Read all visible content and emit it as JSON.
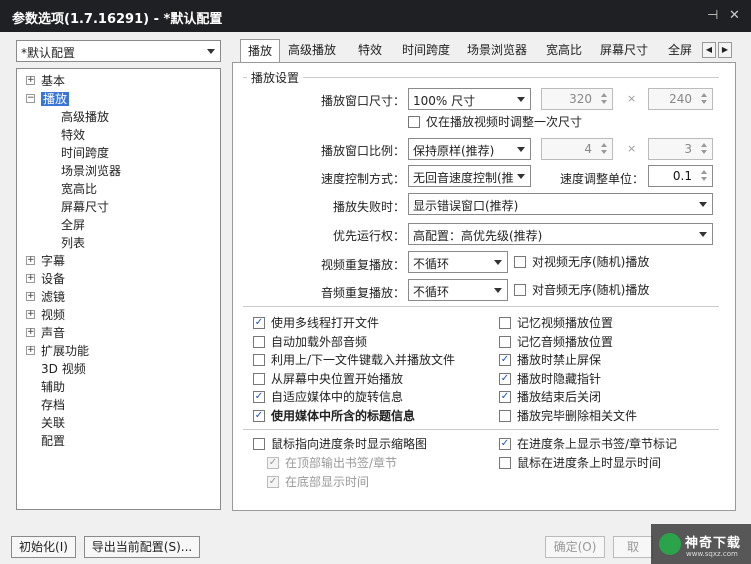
{
  "window": {
    "title": "参数选项(1.7.16291) - *默认配置",
    "pin_glyph": "⊣",
    "close_glyph": "✕"
  },
  "profile_select": {
    "value": "*默认配置"
  },
  "tree": [
    {
      "label": "基本",
      "expander": "+"
    },
    {
      "label": "播放",
      "expander": "−",
      "selected": true
    },
    {
      "label": "高级播放"
    },
    {
      "label": "特效"
    },
    {
      "label": "时间跨度"
    },
    {
      "label": "场景浏览器"
    },
    {
      "label": "宽高比"
    },
    {
      "label": "屏幕尺寸"
    },
    {
      "label": "全屏"
    },
    {
      "label": "列表"
    },
    {
      "label": "字幕",
      "expander": "+"
    },
    {
      "label": "设备",
      "expander": "+"
    },
    {
      "label": "滤镜",
      "expander": "+"
    },
    {
      "label": "视频",
      "expander": "+"
    },
    {
      "label": "声音",
      "expander": "+"
    },
    {
      "label": "扩展功能",
      "expander": "+"
    },
    {
      "label": "3D 视频"
    },
    {
      "label": "辅助"
    },
    {
      "label": "存档"
    },
    {
      "label": "关联"
    },
    {
      "label": "配置"
    }
  ],
  "tabs": [
    "播放",
    "高级播放",
    "特效",
    "时间跨度",
    "场景浏览器",
    "宽高比",
    "屏幕尺寸",
    "全屏"
  ],
  "tab_nav": {
    "prev": "◀",
    "next": "▶"
  },
  "group": {
    "legend": "播放设置"
  },
  "form": {
    "window_size_label": "播放窗口尺寸：",
    "window_size_value": "100% 尺寸",
    "width": "320",
    "height": "240",
    "times": "×",
    "adjust_once": "仅在播放视频时调整一次尺寸",
    "ratio_label": "播放窗口比例：",
    "ratio_value": "保持原样(推荐)",
    "ratio_w": "4",
    "ratio_h": "3",
    "speed_label": "速度控制方式：",
    "speed_value": "无回音速度控制(推",
    "speed_unit_label": "速度调整单位：",
    "speed_unit_value": "0.1",
    "fail_label": "播放失败时：",
    "fail_value": "显示错误窗口(推荐)",
    "priority_label": "优先运行权：",
    "priority_value": "高配置：高优先级(推荐)",
    "video_repeat_label": "视频重复播放：",
    "video_repeat_value": "不循环",
    "video_random": "对视频无序(随机)播放",
    "audio_repeat_label": "音频重复播放：",
    "audio_repeat_value": "不循环",
    "audio_random": "对音频无序(随机)播放"
  },
  "options_left": [
    {
      "label": "使用多线程打开文件",
      "checked": true
    },
    {
      "label": "自动加载外部音频",
      "checked": false
    },
    {
      "label": "利用上/下一文件键载入并播放文件",
      "checked": false
    },
    {
      "label": "从屏幕中央位置开始播放",
      "checked": false
    },
    {
      "label": "自适应媒体中的旋转信息",
      "checked": true
    },
    {
      "label": "使用媒体中所含的标题信息",
      "checked": true,
      "bold": true
    }
  ],
  "options_right": [
    {
      "label": "记忆视频播放位置",
      "checked": false
    },
    {
      "label": "记忆音频播放位置",
      "checked": false
    },
    {
      "label": "播放时禁止屏保",
      "checked": true
    },
    {
      "label": "播放时隐藏指针",
      "checked": true
    },
    {
      "label": "播放结束后关闭",
      "checked": true
    },
    {
      "label": "播放完毕删除相关文件",
      "checked": false
    }
  ],
  "seek_options": {
    "thumb": "鼠标指向进度条时显示缩略图",
    "top_bookmark": "在顶部输出书签/章节",
    "bottom_time": "在底部显示时间",
    "show_marks": "在进度条上显示书签/章节标记",
    "show_time": "鼠标在进度条上时显示时间"
  },
  "buttons": {
    "init": "初始化(I)",
    "export": "导出当前配置(S)...",
    "ok": "确定(O)",
    "cancel": "取"
  },
  "watermark": {
    "brand": "神奇下载",
    "site": "www.sqxz.com"
  },
  "check_glyph": "✓"
}
